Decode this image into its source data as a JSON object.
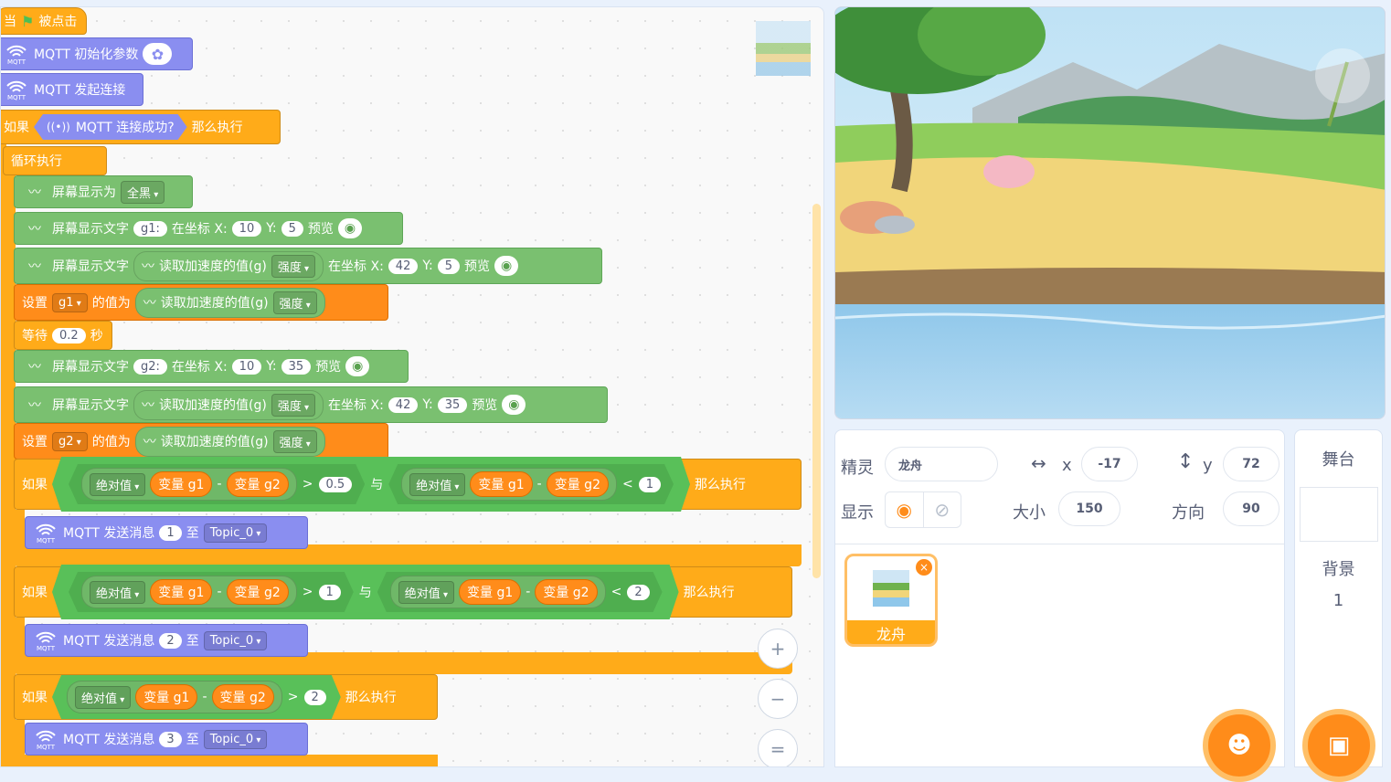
{
  "blocks": {
    "hat": {
      "when": "当",
      "flag": "被点击"
    },
    "init": {
      "label": "MQTT 初始化参数"
    },
    "connect": {
      "label": "MQTT 发起连接"
    },
    "if_connected": {
      "if": "如果",
      "cond": "MQTT 连接成功?",
      "then": "那么执行"
    },
    "loop": {
      "label": "循环执行"
    },
    "screen_fill": {
      "label": "屏幕显示为",
      "value": "全黑"
    },
    "show1": {
      "label": "屏幕显示文字",
      "text": "g1:",
      "at": "在坐标 X:",
      "x": "10",
      "ylab": "Y:",
      "y": "5",
      "preview": "预览"
    },
    "show2": {
      "label": "屏幕显示文字",
      "reporter": "读取加速度的值(g)",
      "opt": "强度",
      "at": "在坐标 X:",
      "x": "42",
      "ylab": "Y:",
      "y": "5",
      "preview": "预览"
    },
    "set1": {
      "set": "设置",
      "var": "g1",
      "to": "的值为",
      "reporter": "读取加速度的值(g)",
      "opt": "强度"
    },
    "wait": {
      "label": "等待",
      "value": "0.2",
      "unit": "秒"
    },
    "show3": {
      "label": "屏幕显示文字",
      "text": "g2:",
      "at": "在坐标 X:",
      "x": "10",
      "ylab": "Y:",
      "y": "35",
      "preview": "预览"
    },
    "show4": {
      "label": "屏幕显示文字",
      "reporter": "读取加速度的值(g)",
      "opt": "强度",
      "at": "在坐标 X:",
      "x": "42",
      "ylab": "Y:",
      "y": "35",
      "preview": "预览"
    },
    "set2": {
      "set": "设置",
      "var": "g2",
      "to": "的值为",
      "reporter": "读取加速度的值(g)",
      "opt": "强度"
    },
    "if1": {
      "if": "如果",
      "abs": "绝对值",
      "v1": "变量 g1",
      "minus": "-",
      "v2": "变量 g2",
      "gt": ">",
      "a": "0.5",
      "and": "与",
      "lt": "<",
      "b": "1",
      "then": "那么执行"
    },
    "send1": {
      "label": "MQTT 发送消息",
      "msg": "1",
      "to": "至",
      "topic": "Topic_0"
    },
    "if2": {
      "if": "如果",
      "abs": "绝对值",
      "v1": "变量 g1",
      "minus": "-",
      "v2": "变量 g2",
      "gt": ">",
      "a": "1",
      "and": "与",
      "lt": "<",
      "b": "2",
      "then": "那么执行"
    },
    "send2": {
      "label": "MQTT 发送消息",
      "msg": "2",
      "to": "至",
      "topic": "Topic_0"
    },
    "if3": {
      "if": "如果",
      "abs": "绝对值",
      "v1": "变量 g1",
      "minus": "-",
      "v2": "变量 g2",
      "gt": ">",
      "a": "2",
      "then": "那么执行"
    },
    "send3": {
      "label": "MQTT 发送消息",
      "msg": "3",
      "to": "至",
      "topic": "Topic_0"
    },
    "mqtt_badge": "MQTT"
  },
  "zoom": {
    "in": "+",
    "out": "−",
    "reset": "="
  },
  "sprite_info": {
    "sprite_label": "精灵",
    "sprite_name": "龙舟",
    "x_label": "x",
    "x": "-17",
    "y_label": "y",
    "y": "72",
    "show_label": "显示",
    "size_label": "大小",
    "size": "150",
    "dir_label": "方向",
    "dir": "90"
  },
  "sprites": [
    {
      "name": "龙舟"
    }
  ],
  "stage_panel": {
    "title": "舞台",
    "backdrop_label": "背景",
    "backdrop_count": "1"
  },
  "colors": {
    "events": "#ffab19",
    "control": "#ffab19",
    "variables": "#ff8c1a",
    "operators": "#59c059",
    "extension": "#7ac070",
    "mqtt": "#8a8ef0",
    "accent": "#ff8c1a"
  }
}
